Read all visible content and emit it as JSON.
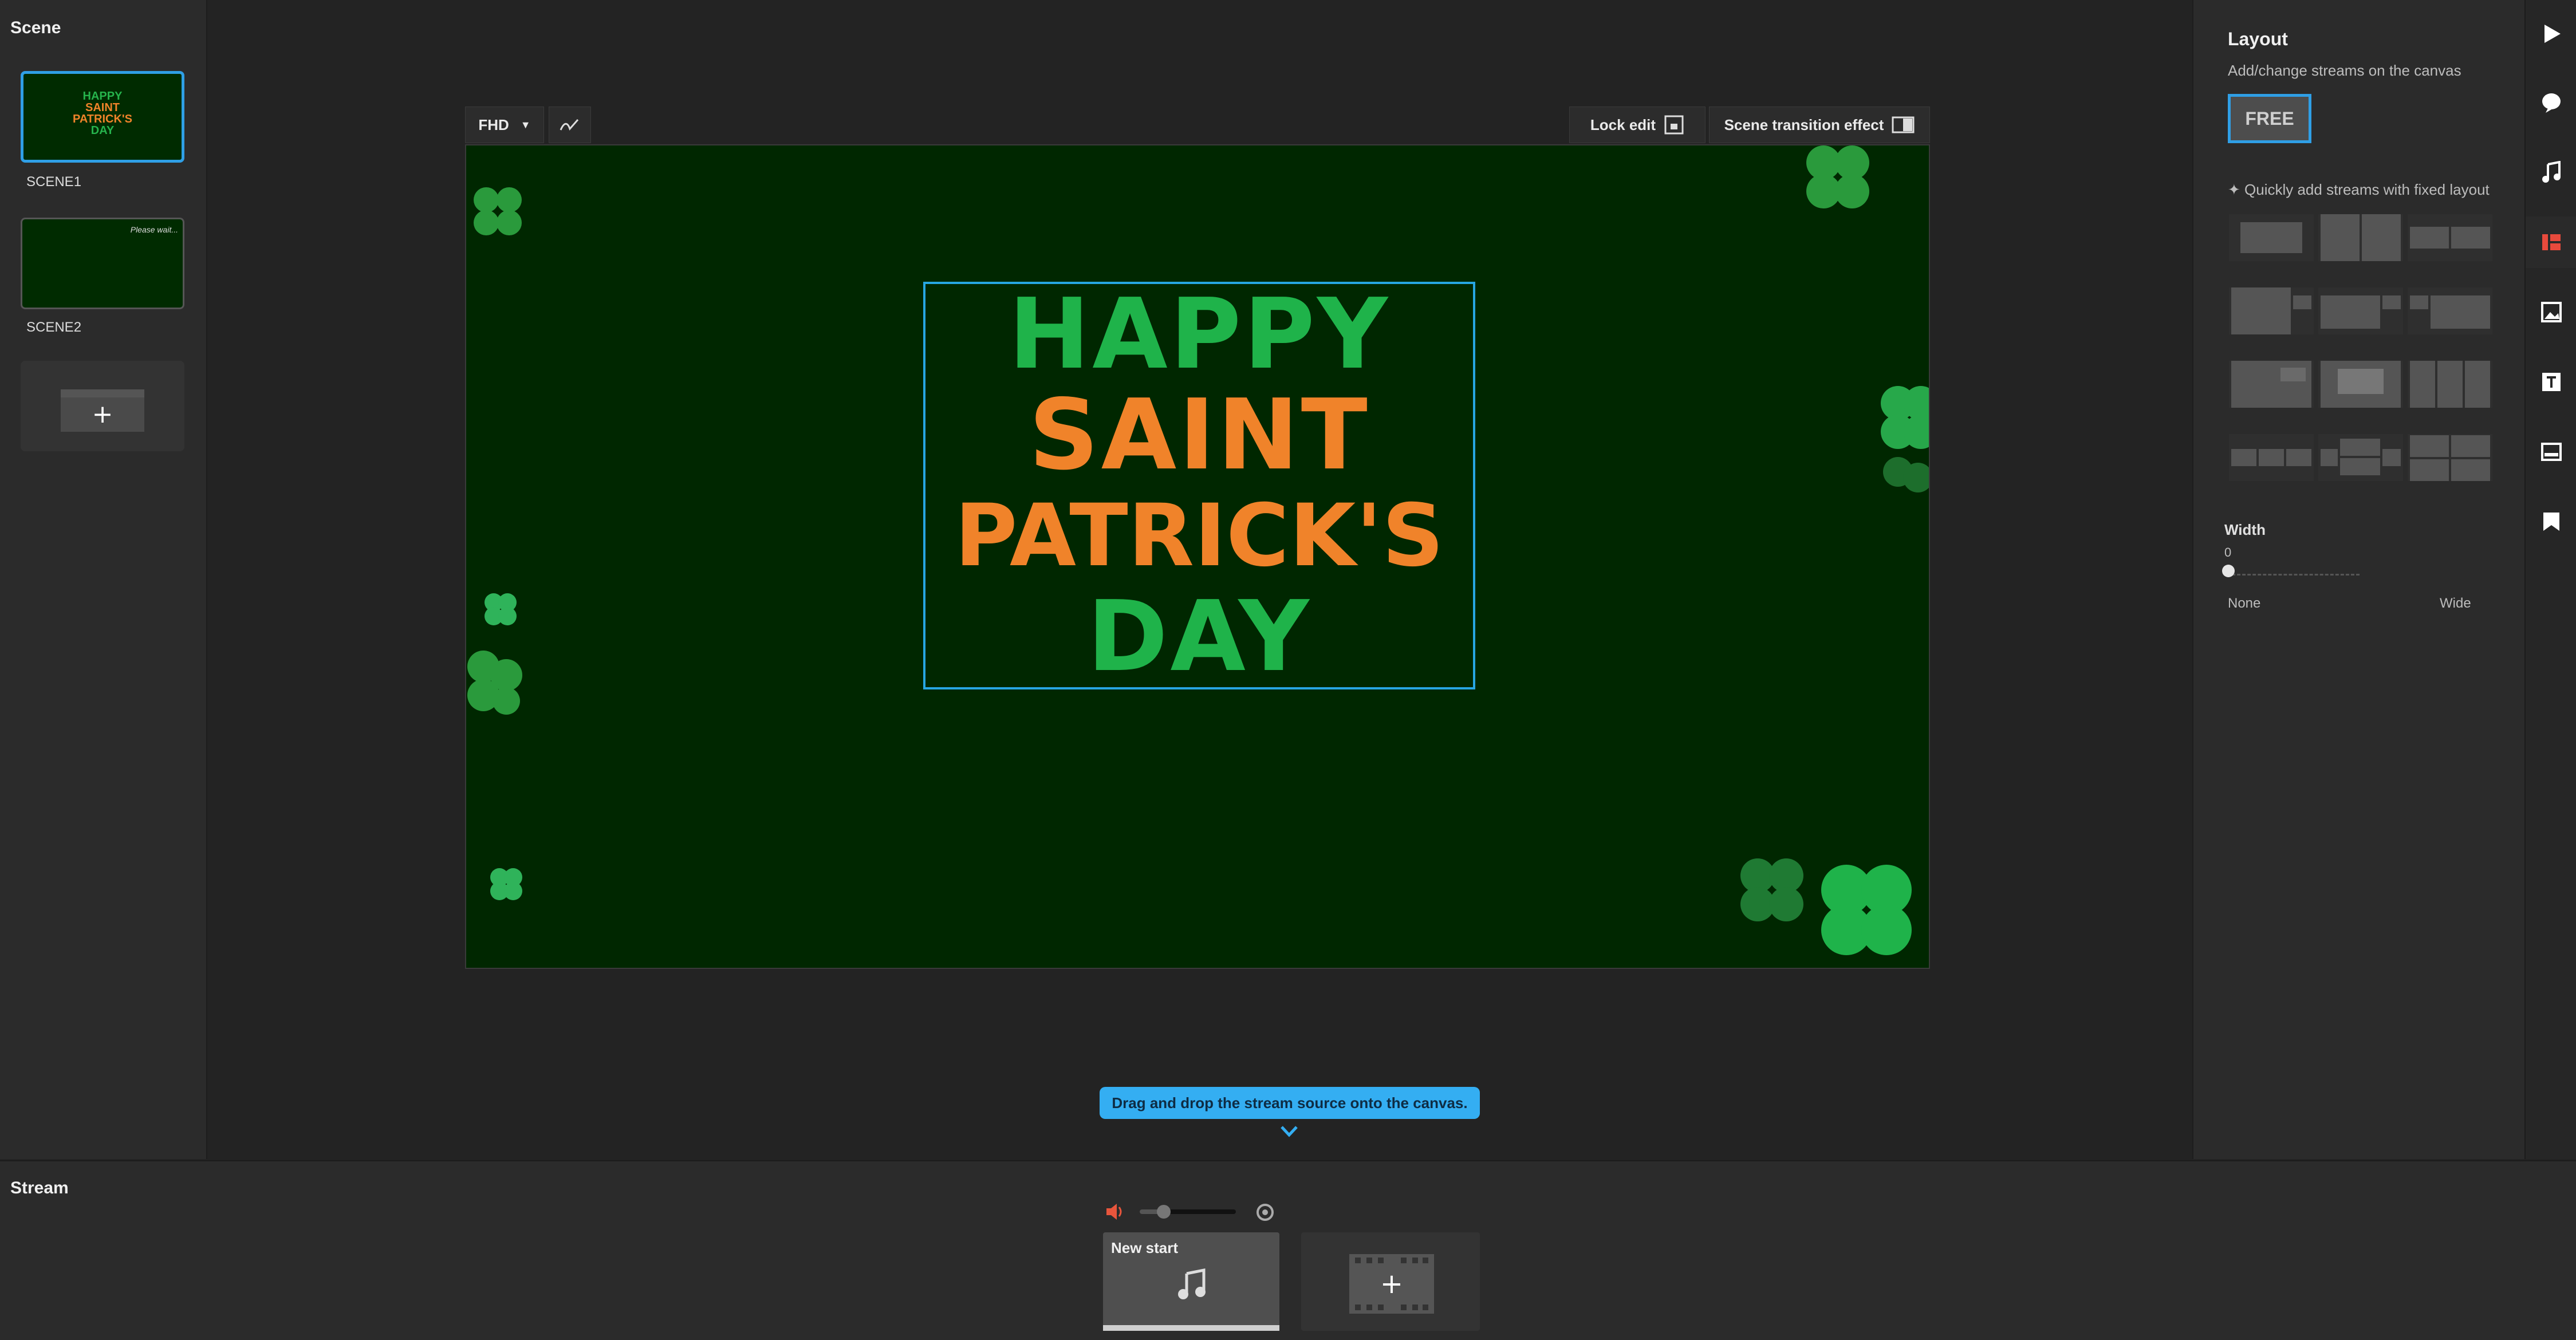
{
  "scene": {
    "title": "Scene",
    "items": [
      {
        "label": "SCENE1",
        "thumb_lines": [
          "HAPPY",
          "SAINT",
          "PATRICK'S",
          "DAY"
        ]
      },
      {
        "label": "SCENE2",
        "thumb_text": "Please wait..."
      }
    ]
  },
  "toolbar": {
    "resolution": "FHD",
    "lock_edit_label": "Lock edit",
    "transition_label": "Scene transition effect"
  },
  "canvas": {
    "lines": [
      "HAPPY",
      "SAINT",
      "PATRICK'S",
      "DAY"
    ],
    "colors": {
      "bg": "#002700",
      "green": "#1fb34a",
      "orange": "#f0832a",
      "selection": "#27a6e3"
    }
  },
  "hint": {
    "text": "Drag and drop the stream source onto the canvas."
  },
  "layout": {
    "title": "Layout",
    "subtitle": "Add/change streams on the canvas",
    "free_label": "FREE",
    "quick_label": "Quickly add streams with fixed layout",
    "width_label": "Width",
    "width_value": "0",
    "min_label": "None",
    "max_label": "Wide"
  },
  "stream": {
    "title": "Stream",
    "item_label": "New start"
  },
  "icons": [
    "play-icon",
    "chat-icon",
    "music-icon",
    "layout-icon",
    "image-icon",
    "text-icon",
    "caption-icon",
    "bookmark-icon"
  ]
}
